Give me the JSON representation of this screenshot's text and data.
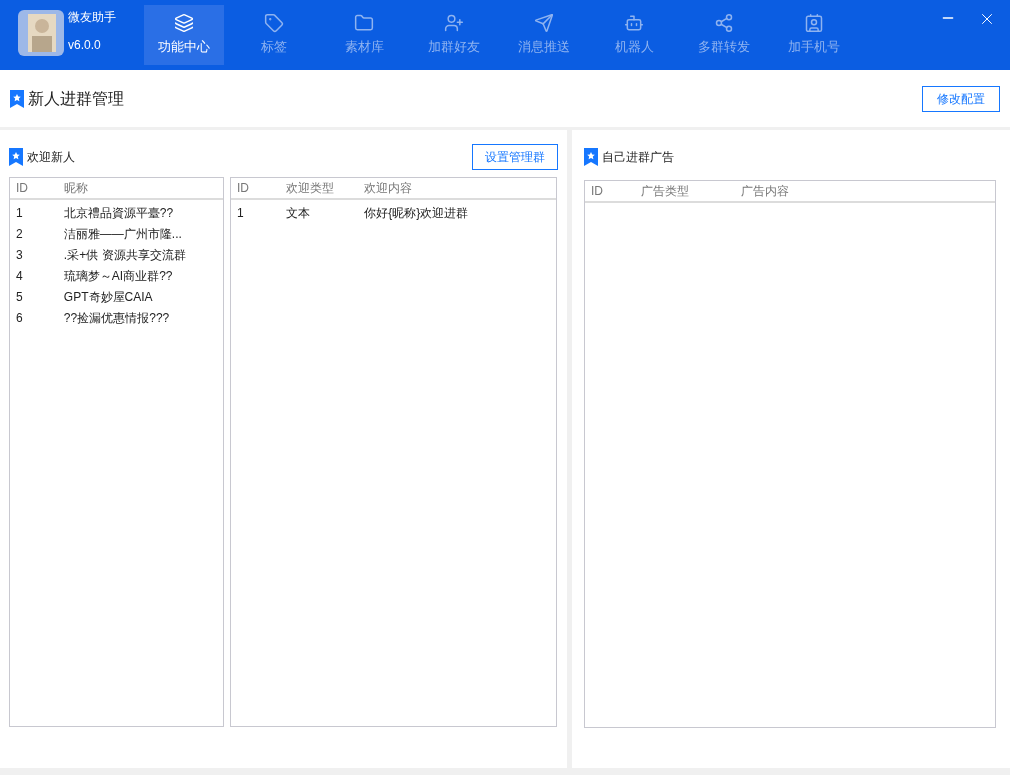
{
  "app": {
    "name": "微友助手",
    "version": "v6.0.0"
  },
  "nav": [
    {
      "label": "功能中心",
      "selected": true
    },
    {
      "label": "标签",
      "selected": false
    },
    {
      "label": "素材库",
      "selected": false
    },
    {
      "label": "加群好友",
      "selected": false
    },
    {
      "label": "消息推送",
      "selected": false
    },
    {
      "label": "机器人",
      "selected": false
    },
    {
      "label": "多群转发",
      "selected": false
    },
    {
      "label": "加手机号",
      "selected": false
    }
  ],
  "page": {
    "title": "新人进群管理",
    "button": "修改配置"
  },
  "welcome": {
    "title": "欢迎新人",
    "button": "设置管理群",
    "groups": {
      "columns": [
        "ID",
        "昵称"
      ],
      "rows": [
        [
          "1",
          "北京禮品資源平臺??"
        ],
        [
          "2",
          "洁丽雅——广州市隆..."
        ],
        [
          "3",
          ".采+供 资源共享交流群"
        ],
        [
          "4",
          "琉璃梦～AI商业群??"
        ],
        [
          "5",
          "GPT奇妙屋CAIA"
        ],
        [
          "6",
          "??捡漏优惠情报???"
        ]
      ]
    },
    "messages": {
      "columns": [
        "ID",
        "欢迎类型",
        "欢迎内容"
      ],
      "rows": [
        [
          "1",
          "文本",
          "你好{昵称}欢迎进群"
        ]
      ]
    }
  },
  "ads": {
    "title": "自己进群广告",
    "table": {
      "columns": [
        "ID",
        "广告类型",
        "广告内容"
      ]
    }
  }
}
